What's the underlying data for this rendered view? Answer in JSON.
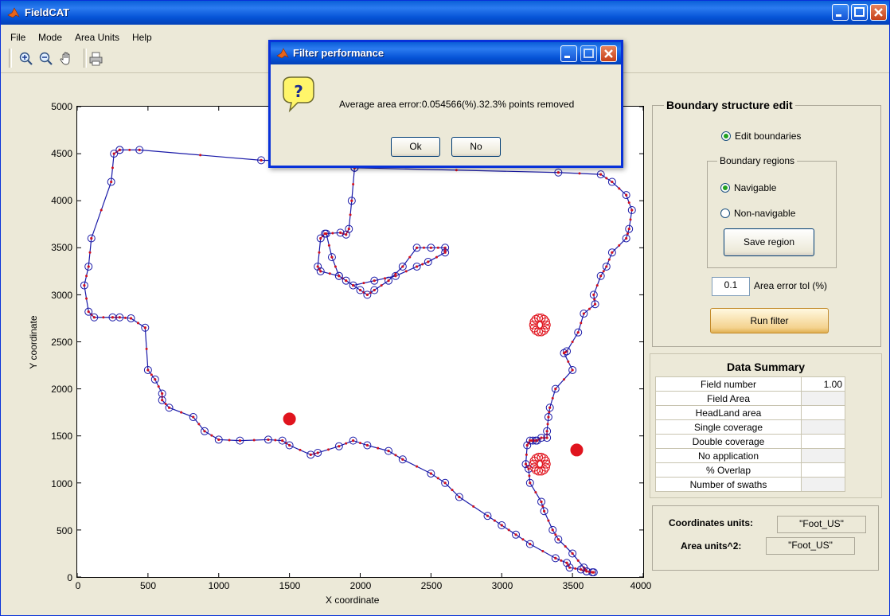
{
  "window": {
    "title": "FieldCAT"
  },
  "menu": [
    "File",
    "Mode",
    "Area Units",
    "Help"
  ],
  "toolbar": {
    "tools": [
      "zoom-in-icon",
      "zoom-out-icon",
      "pan-hand-icon",
      "print-icon"
    ]
  },
  "plot": {
    "xlabel": "X coordinate",
    "ylabel": "Y coordinate",
    "xticks": [
      "0",
      "500",
      "1000",
      "1500",
      "2000",
      "2500",
      "3000",
      "3500",
      "4000"
    ],
    "yticks": [
      "0",
      "500",
      "1000",
      "1500",
      "2000",
      "2500",
      "3000",
      "3500",
      "4000",
      "4500",
      "5000"
    ]
  },
  "chart_data": {
    "type": "line",
    "xlim": [
      0,
      4000
    ],
    "ylim": [
      0,
      5000
    ],
    "xlabel": "X coordinate",
    "ylabel": "Y coordinate",
    "colors": {
      "boundary": "#1a1aa8",
      "markers": "#d01020",
      "obstacles": "#e0141e"
    },
    "series": [
      {
        "name": "",
        "x": [
          300,
          440,
          1300,
          1640,
          1960,
          3400,
          3700,
          3780,
          3880,
          3920,
          3900,
          3880,
          3780,
          3740,
          3700,
          3650,
          3660,
          3580,
          3540,
          3460,
          3440,
          3500,
          3380,
          3340,
          3330,
          3320,
          3320,
          3280,
          3250,
          3240,
          3220,
          3200,
          3180,
          3170,
          3190,
          3200,
          3280,
          3300,
          3360,
          3400,
          3500,
          3580,
          3600,
          3650,
          3640,
          3600,
          3560,
          3480,
          3460,
          3380,
          3200,
          3100,
          3000,
          2900,
          2700,
          2600,
          2500,
          2300,
          2200,
          2050,
          1950,
          1850,
          1700,
          1650,
          1500,
          1450,
          1350,
          1150,
          1000,
          900,
          820,
          650,
          600,
          600,
          550,
          500,
          480,
          380,
          300,
          250,
          120,
          80,
          50,
          80,
          100,
          240,
          260,
          300
        ],
        "y": [
          4540,
          4540,
          4430,
          4420,
          4350,
          4300,
          4280,
          4200,
          4060,
          3900,
          3700,
          3600,
          3450,
          3300,
          3200,
          3000,
          2900,
          2800,
          2600,
          2400,
          2380,
          2200,
          2000,
          1800,
          1700,
          1550,
          1480,
          1480,
          1450,
          1450,
          1450,
          1450,
          1400,
          1200,
          1150,
          1000,
          800,
          700,
          500,
          400,
          250,
          100,
          60,
          50,
          50,
          60,
          80,
          100,
          150,
          200,
          350,
          450,
          550,
          650,
          850,
          1000,
          1100,
          1250,
          1340,
          1400,
          1450,
          1390,
          1320,
          1300,
          1400,
          1450,
          1460,
          1450,
          1460,
          1550,
          1700,
          1800,
          1880,
          1950,
          2100,
          2200,
          2650,
          2750,
          2760,
          2760,
          2760,
          2820,
          3100,
          3300,
          3600,
          4200,
          4500,
          4540
        ]
      },
      {
        "name": "",
        "x": [
          1960,
          1940,
          1920,
          1900,
          1860,
          1750,
          1720,
          1700,
          1720,
          1850,
          1900,
          2000,
          2050,
          2100,
          2200,
          2300,
          2400,
          2500,
          2600,
          2600,
          2480,
          2400,
          2250,
          2100,
          1950,
          1850,
          1800,
          1760
        ],
        "y": [
          4350,
          4000,
          3700,
          3640,
          3660,
          3650,
          3600,
          3300,
          3250,
          3200,
          3150,
          3050,
          3000,
          3050,
          3150,
          3300,
          3500,
          3500,
          3500,
          3450,
          3350,
          3300,
          3200,
          3150,
          3100,
          3200,
          3400,
          3650
        ]
      }
    ],
    "obstacles": [
      {
        "shape": "circle",
        "x": 1500,
        "y": 1680
      },
      {
        "shape": "circle",
        "x": 3530,
        "y": 1350
      },
      {
        "shape": "ring-cluster",
        "x": 3270,
        "y": 2680
      },
      {
        "shape": "ring-cluster",
        "x": 3270,
        "y": 1200
      }
    ]
  },
  "boundary_panel": {
    "title": "Boundary structure edit",
    "edit_boundaries": "Edit boundaries",
    "regions_title": "Boundary regions",
    "navigable": "Navigable",
    "non_navigable": "Non-navigable",
    "save_region": "Save region",
    "error_tol_value": "0.1",
    "error_tol_label": "Area error tol (%)",
    "run_filter": "Run filter"
  },
  "summary": {
    "title": "Data Summary",
    "rows": [
      {
        "label": "Field number",
        "value": "1.00"
      },
      {
        "label": "Field Area",
        "value": ""
      },
      {
        "label": "HeadLand area",
        "value": ""
      },
      {
        "label": "Single coverage",
        "value": ""
      },
      {
        "label": "Double coverage",
        "value": ""
      },
      {
        "label": "No application",
        "value": ""
      },
      {
        "label": "% Overlap",
        "value": ""
      },
      {
        "label": "Number of swaths",
        "value": ""
      }
    ]
  },
  "units": {
    "coord_label": "Coordinates units:",
    "coord_value": "\"Foot_US\"",
    "area_label": "Area units^2:",
    "area_value": "\"Foot_US\""
  },
  "dialog": {
    "title": "Filter performance",
    "message": "Average area error:0.054566(%).32.3% points removed",
    "ok": "Ok",
    "no": "No"
  }
}
